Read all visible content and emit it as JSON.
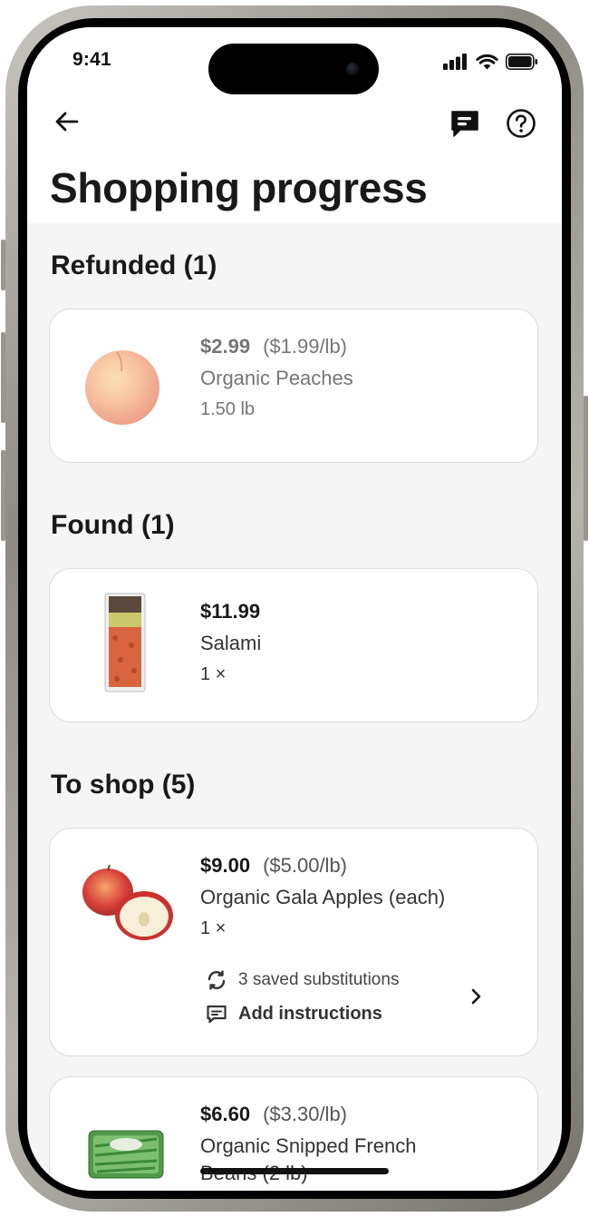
{
  "status_bar": {
    "time": "9:41"
  },
  "header": {
    "title": "Shopping progress",
    "back_icon": "arrow-left-icon",
    "chat_icon": "chat-bubble-icon",
    "help_icon": "question-circle-icon"
  },
  "sections": [
    {
      "title": "Refunded (1)",
      "items": [
        {
          "price": "$2.99",
          "unit_price": "($1.99/lb)",
          "name": "Organic Peaches",
          "qty": "1.50 lb"
        }
      ]
    },
    {
      "title": "Found (1)",
      "items": [
        {
          "price": "$11.99",
          "name": "Salami",
          "qty": "1 ×"
        }
      ]
    },
    {
      "title": "To shop (5)",
      "items": [
        {
          "price": "$9.00",
          "unit_price": "($5.00/lb)",
          "name": "Organic Gala Apples (each)",
          "qty": "1 ×",
          "substitutions": "3 saved substitutions",
          "instructions": "Add instructions"
        },
        {
          "price": "$6.60",
          "unit_price": "($3.30/lb)",
          "name": "Organic Snipped French",
          "name_line2": "Beans (2 lb)"
        }
      ]
    }
  ],
  "colors": {
    "title_text": "#191919",
    "muted_text": "#767676",
    "screen_bg": "#f5f5f5",
    "card_border": "#dcdcdc"
  }
}
